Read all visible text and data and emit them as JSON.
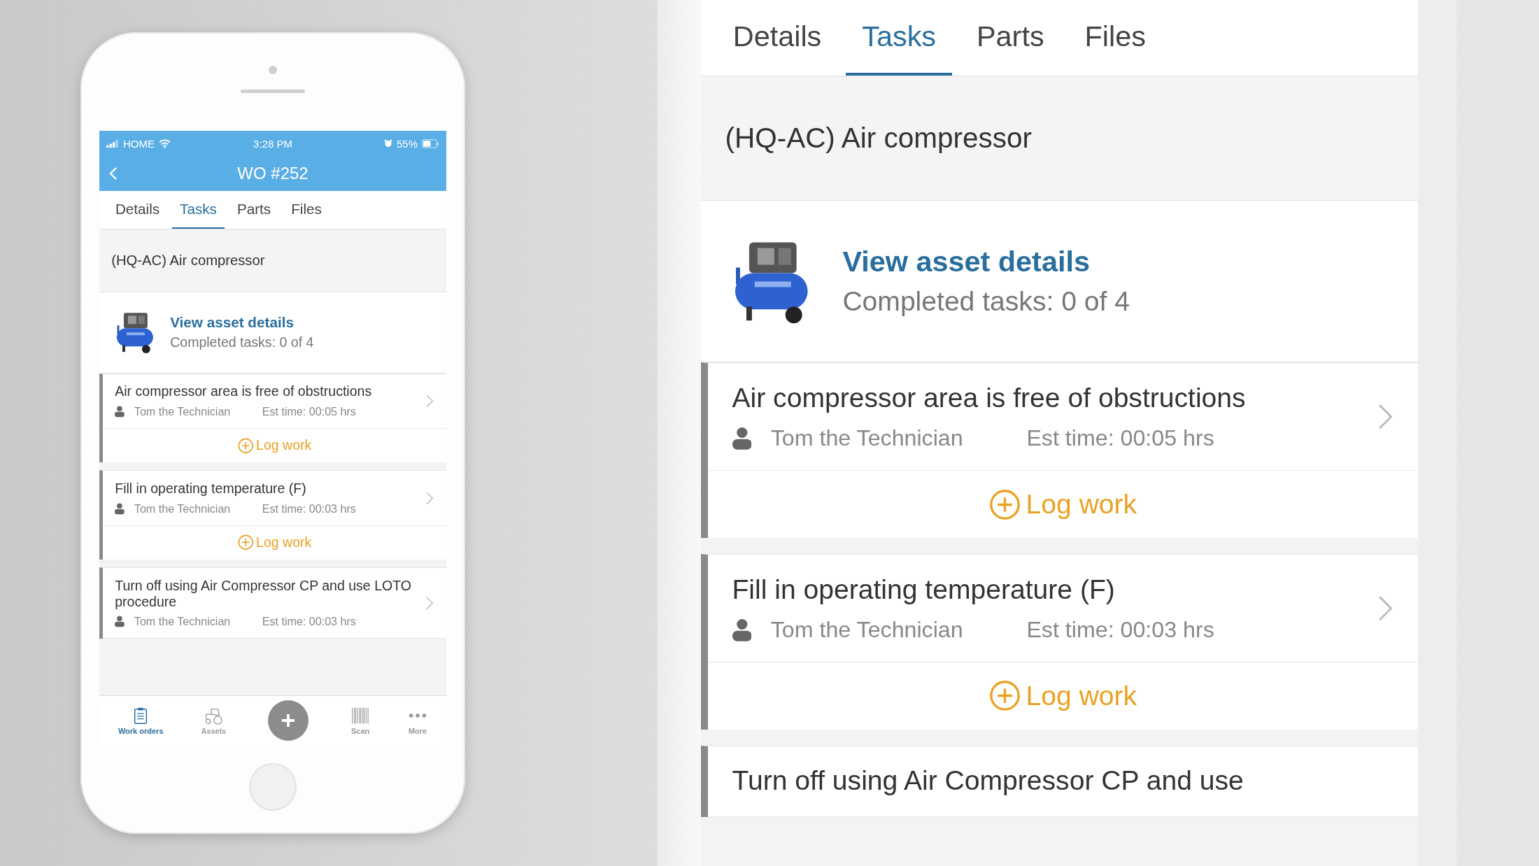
{
  "phone": {
    "status_bar": {
      "carrier": "HOME",
      "time": "3:28 PM",
      "battery": "55%"
    },
    "header": {
      "title": "WO #252"
    },
    "tabs": [
      {
        "label": "Details",
        "selected": false
      },
      {
        "label": "Tasks",
        "selected": true
      },
      {
        "label": "Parts",
        "selected": false
      },
      {
        "label": "Files",
        "selected": false
      }
    ],
    "asset": {
      "name": "(HQ-AC) Air compressor",
      "link": "View asset details",
      "progress": "Completed tasks: 0 of 4"
    },
    "tasks": [
      {
        "title": "Air compressor area is free of obstructions",
        "assignee": "Tom the Technician",
        "est_time": "Est time: 00:05 hrs",
        "log_work": "Log work"
      },
      {
        "title": "Fill in operating temperature (F)",
        "assignee": "Tom the Technician",
        "est_time": "Est time: 00:03 hrs",
        "log_work": "Log work"
      },
      {
        "title": "Turn off using Air Compressor CP and use LOTO procedure",
        "assignee": "Tom the Technician",
        "est_time": "Est time: 00:03 hrs"
      }
    ],
    "tab_bar": [
      {
        "kind": "clipboard",
        "label": "Work orders",
        "selected": true
      },
      {
        "kind": "tractor",
        "label": "Assets",
        "selected": false
      },
      {
        "kind": "add"
      },
      {
        "kind": "barcode",
        "label": "Scan",
        "selected": false
      },
      {
        "kind": "dots",
        "label": "More",
        "selected": false
      }
    ]
  },
  "zoom_view": {
    "tabs": [
      {
        "label": "Details",
        "selected": false
      },
      {
        "label": "Tasks",
        "selected": true
      },
      {
        "label": "Parts",
        "selected": false
      },
      {
        "label": "Files",
        "selected": false
      }
    ],
    "asset": {
      "name": "(HQ-AC) Air compressor",
      "link": "View asset details",
      "progress": "Completed tasks: 0 of 4"
    },
    "tasks": [
      {
        "title": "Air compressor area is free of obstructions",
        "assignee": "Tom the Technician",
        "est_time": "Est time: 00:05 hrs",
        "log_work": "Log work"
      },
      {
        "title": "Fill in operating temperature (F)",
        "assignee": "Tom the Technician",
        "est_time": "Est time: 00:03 hrs",
        "log_work": "Log work"
      },
      {
        "title": "Turn off using Air Compressor CP and use"
      }
    ]
  }
}
